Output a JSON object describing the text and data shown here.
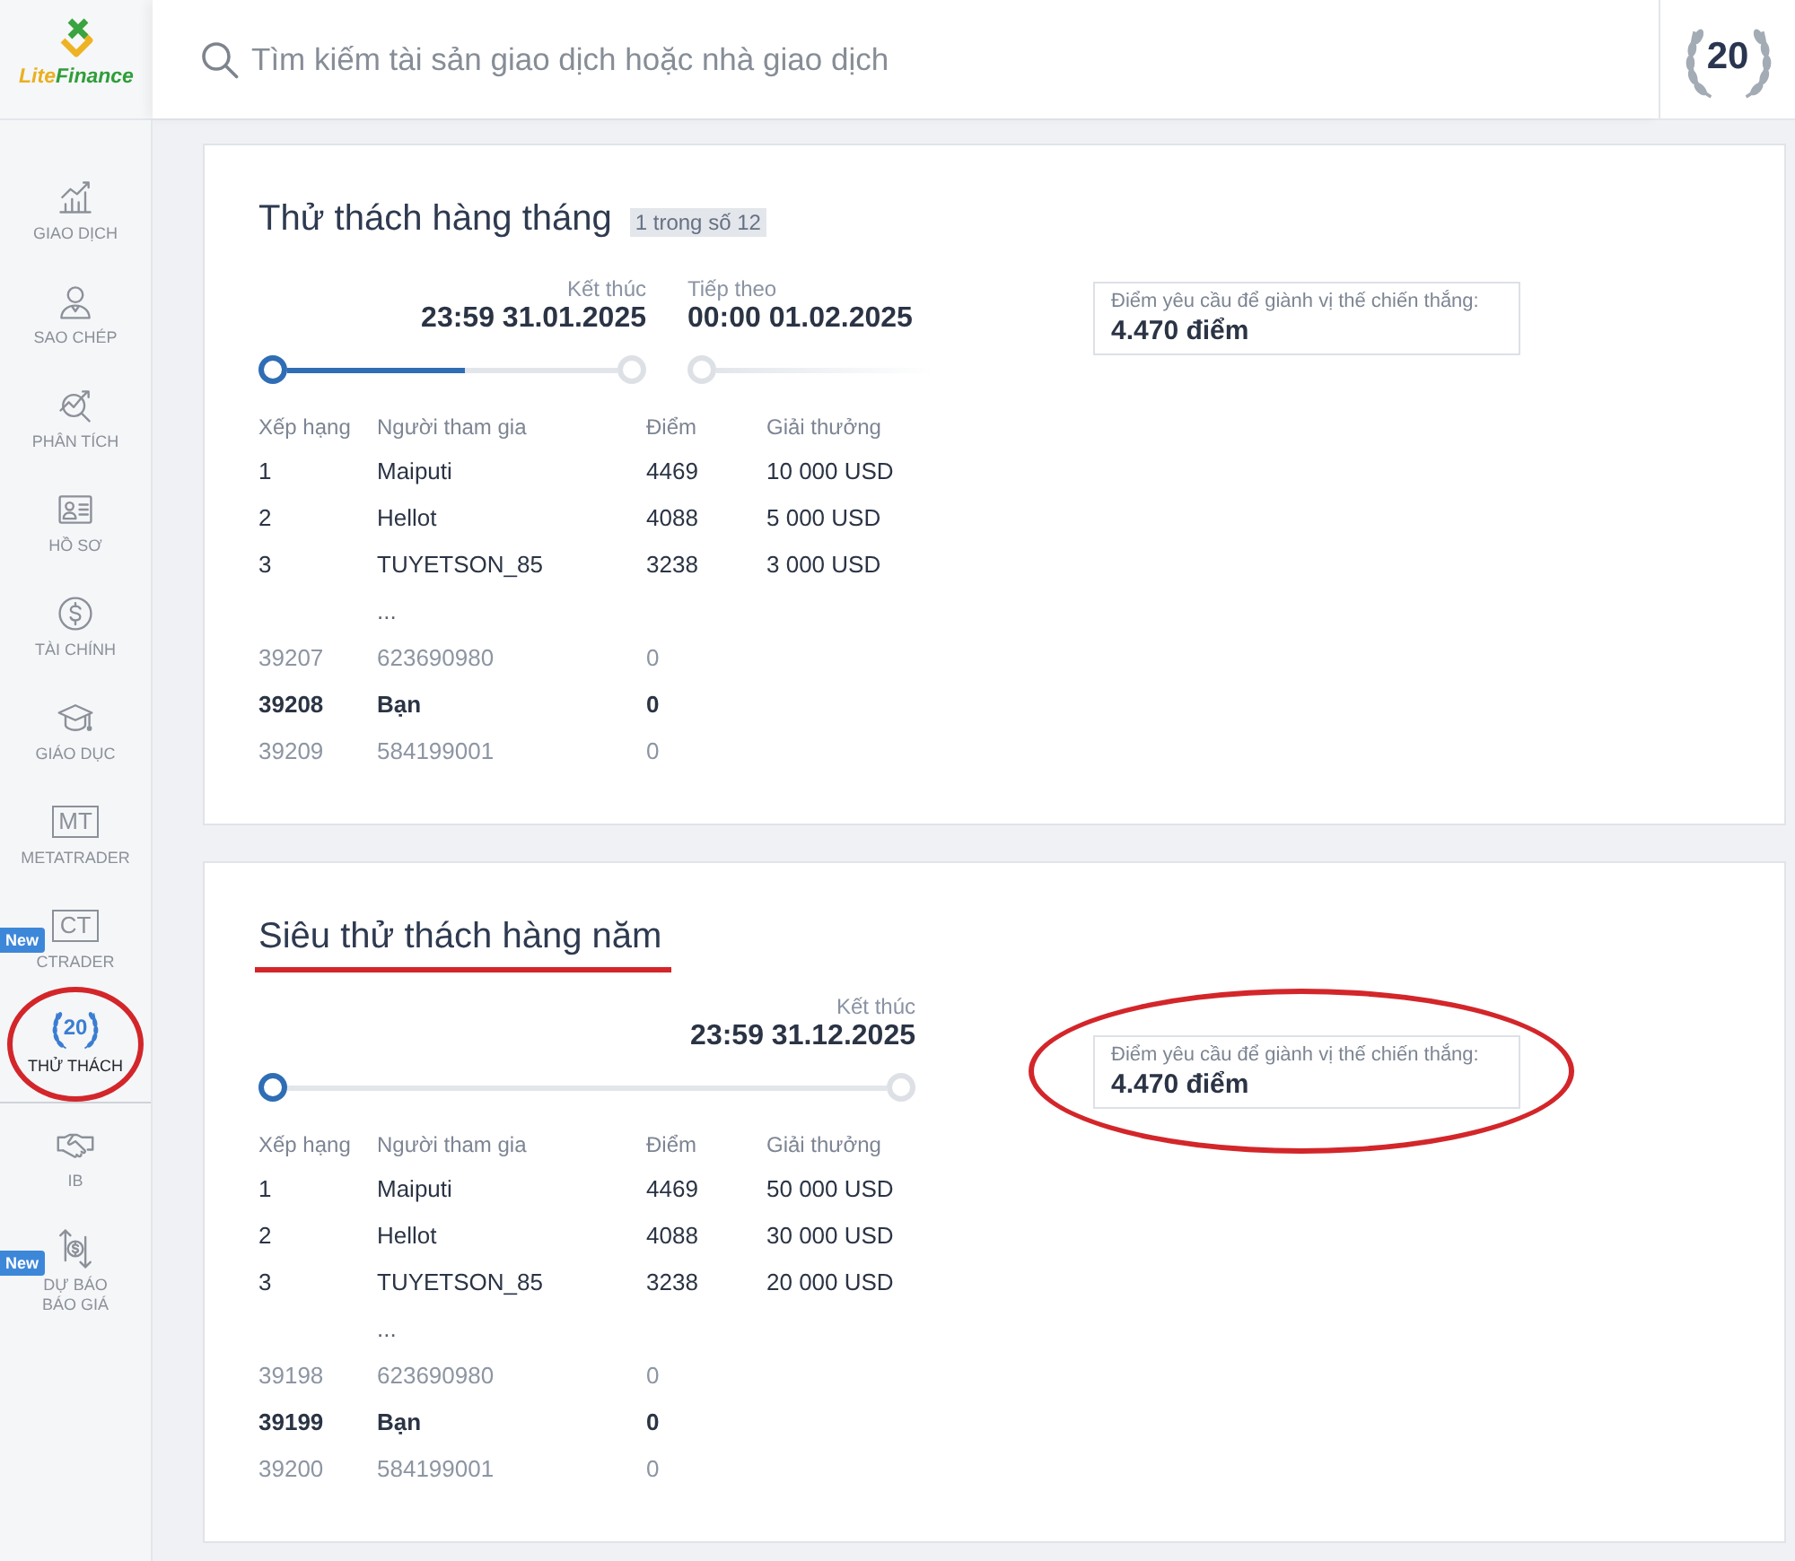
{
  "logo": {
    "parts": [
      {
        "text": "Lite",
        "color": "#e9b120"
      },
      {
        "text": "Finance",
        "color": "#2f9e3a"
      }
    ]
  },
  "search": {
    "placeholder": "Tìm kiếm tài sản giao dịch hoặc nhà giao dịch"
  },
  "anniversary_badge": {
    "text": "20"
  },
  "sidebar": {
    "sections": [
      {
        "items": [
          {
            "kind": "glyph",
            "label": "GIAO DỊCH",
            "selected": false,
            "circled": false
          },
          {
            "kind": "glyph",
            "label": "SAO CHÉP",
            "selected": false,
            "circled": false
          },
          {
            "kind": "glyph",
            "label": "PHÂN TÍCH",
            "selected": false,
            "circled": false
          },
          {
            "kind": "glyph",
            "label": "HỒ SƠ",
            "selected": false,
            "circled": false
          },
          {
            "kind": "glyph",
            "label": "TÀI CHÍNH",
            "selected": false,
            "circled": false
          },
          {
            "kind": "glyph",
            "label": "GIÁO DỤC",
            "selected": false,
            "circled": false
          },
          {
            "kind": "text_box",
            "icon_text": "MT",
            "label": "METATRADER",
            "selected": false,
            "circled": false
          },
          {
            "kind": "text_box",
            "icon_text": "CT",
            "label": "CTRADER",
            "selected": false,
            "circled": false,
            "badge": "New"
          },
          {
            "kind": "laurel",
            "icon_text": "20",
            "label": "THỬ THÁCH",
            "selected": true,
            "circled": true
          }
        ]
      },
      {
        "items": [
          {
            "kind": "glyph",
            "label": "IB",
            "selected": false,
            "circled": false
          },
          {
            "kind": "glyph",
            "label": "DỰ BÁO\nBÁO GIÁ",
            "selected": false,
            "circled": false,
            "badge": "New"
          }
        ]
      }
    ]
  },
  "challenges": [
    {
      "title": "Thử thách hàng tháng",
      "underlined": false,
      "counter": "1 trong số 12",
      "timeline": {
        "level": 0.54,
        "milestones": [
          {
            "kind": "end",
            "label": "Kết thúc",
            "date": "23:59 31.01.2025"
          },
          {
            "kind": "next",
            "label": "Tiếp theo",
            "date": "00:00 01.02.2025"
          }
        ]
      },
      "requirement": {
        "label": "Điểm yêu cầu để giành vị thế chiến thắng:",
        "value": "4.470 điểm",
        "circled": false
      },
      "table": {
        "columns": [
          "Xếp hạng",
          "Người tham gia",
          "Điểm",
          "Giải thưởng"
        ],
        "rows": [
          {
            "kind": "leader",
            "rank": "1",
            "participant": "Maiputi",
            "points": "4469",
            "prize": "10 000 USD"
          },
          {
            "kind": "leader",
            "rank": "2",
            "participant": "Hellot",
            "points": "4088",
            "prize": "5 000 USD"
          },
          {
            "kind": "leader",
            "rank": "3",
            "participant": "TUYETSON_85",
            "points": "3238",
            "prize": "3 000 USD"
          },
          {
            "kind": "gap",
            "participant": "..."
          },
          {
            "kind": "nearby",
            "rank": "39207",
            "participant": "623690980",
            "points": "0"
          },
          {
            "kind": "you",
            "rank": "39208",
            "participant": "Bạn",
            "points": "0"
          },
          {
            "kind": "nearby",
            "rank": "39209",
            "participant": "584199001",
            "points": "0"
          }
        ]
      }
    },
    {
      "title": "Siêu thử thách hàng năm",
      "underlined": true,
      "timeline": {
        "milestones": [
          {
            "kind": "end",
            "label": "Kết thúc",
            "date": "23:59 31.12.2025"
          }
        ]
      },
      "requirement": {
        "label": "Điểm yêu cầu để giành vị thế chiến thắng:",
        "value": "4.470 điểm",
        "circled": true
      },
      "table": {
        "columns": [
          "Xếp hạng",
          "Người tham gia",
          "Điểm",
          "Giải thưởng"
        ],
        "rows": [
          {
            "kind": "leader",
            "rank": "1",
            "participant": "Maiputi",
            "points": "4469",
            "prize": "50 000 USD"
          },
          {
            "kind": "leader",
            "rank": "2",
            "participant": "Hellot",
            "points": "4088",
            "prize": "30 000 USD"
          },
          {
            "kind": "leader",
            "rank": "3",
            "participant": "TUYETSON_85",
            "points": "3238",
            "prize": "20 000 USD"
          },
          {
            "kind": "gap",
            "participant": "..."
          },
          {
            "kind": "nearby",
            "rank": "39198",
            "participant": "623690980",
            "points": "0"
          },
          {
            "kind": "you",
            "rank": "39199",
            "participant": "Bạn",
            "points": "0"
          },
          {
            "kind": "nearby",
            "rank": "39200",
            "participant": "584199001",
            "points": "0"
          }
        ]
      }
    }
  ]
}
